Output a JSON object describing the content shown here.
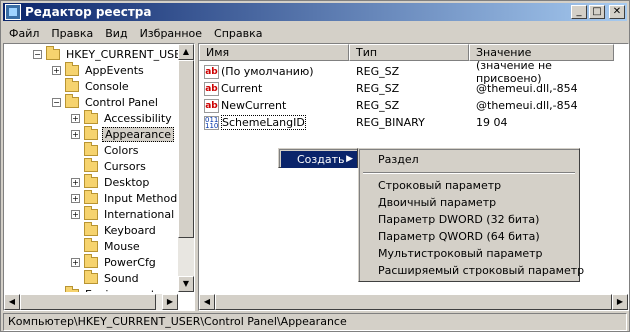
{
  "window": {
    "title": "Редактор реестра",
    "min": "_",
    "max": "□",
    "close": "✕"
  },
  "menu": [
    "Файл",
    "Правка",
    "Вид",
    "Избранное",
    "Справка"
  ],
  "tree": {
    "items": [
      {
        "label": "HKEY_CURRENT_USER",
        "exp": "−",
        "indent": 1
      },
      {
        "label": "AppEvents",
        "exp": "+",
        "indent": 2
      },
      {
        "label": "Console",
        "exp": "",
        "indent": 2
      },
      {
        "label": "Control Panel",
        "exp": "−",
        "indent": 2
      },
      {
        "label": "Accessibility",
        "exp": "+",
        "indent": 3
      },
      {
        "label": "Appearance",
        "exp": "+",
        "indent": 3
      },
      {
        "label": "Colors",
        "exp": "",
        "indent": 3
      },
      {
        "label": "Cursors",
        "exp": "",
        "indent": 3
      },
      {
        "label": "Desktop",
        "exp": "+",
        "indent": 3
      },
      {
        "label": "Input Method",
        "exp": "+",
        "indent": 3
      },
      {
        "label": "International",
        "exp": "+",
        "indent": 3
      },
      {
        "label": "Keyboard",
        "exp": "",
        "indent": 3
      },
      {
        "label": "Mouse",
        "exp": "",
        "indent": 3
      },
      {
        "label": "PowerCfg",
        "exp": "+",
        "indent": 3
      },
      {
        "label": "Sound",
        "exp": "",
        "indent": 3
      },
      {
        "label": "Environment",
        "exp": "",
        "indent": 2
      }
    ],
    "selected": "Appearance"
  },
  "list": {
    "headers": {
      "name": "Имя",
      "type": "Тип",
      "data": "Значение"
    },
    "rows": [
      {
        "icon": "ab",
        "name": "(По умолчанию)",
        "type": "REG_SZ",
        "data": "(значение не присвоено)"
      },
      {
        "icon": "ab",
        "name": "Current",
        "type": "REG_SZ",
        "data": "@themeui.dll,-854"
      },
      {
        "icon": "ab",
        "name": "NewCurrent",
        "type": "REG_SZ",
        "data": "@themeui.dll,-854"
      },
      {
        "icon": "bin",
        "name": "SchemeLangID",
        "type": "REG_BINARY",
        "data": "19 04"
      }
    ]
  },
  "context_menu": {
    "create": "Создать",
    "submenu": [
      "Раздел",
      "Строковый параметр",
      "Двоичный параметр",
      "Параметр DWORD (32 бита)",
      "Параметр QWORD (64 бита)",
      "Мультистроковый параметр",
      "Расширяемый строковый параметр"
    ]
  },
  "status": "Компьютер\\HKEY_CURRENT_USER\\Control Panel\\Appearance",
  "colors": {
    "titlebar_start": "#0a246a",
    "titlebar_end": "#a6caf0",
    "highlight": "#0a246a",
    "face": "#d4d0c8"
  }
}
